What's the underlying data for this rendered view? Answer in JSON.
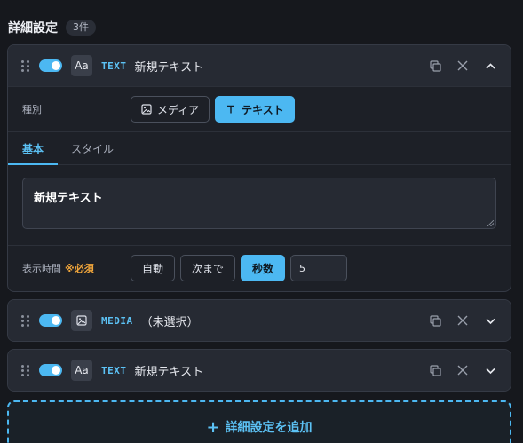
{
  "header": {
    "title": "詳細設定",
    "count": "3件"
  },
  "cards": [
    {
      "type_icon": "Aa",
      "type_label": "TEXT",
      "name": "新規テキスト",
      "toggle_on": true,
      "expanded": true
    },
    {
      "type_icon": "image-icon",
      "type_label": "MEDIA",
      "name": "（未選択）",
      "toggle_on": true,
      "expanded": false
    },
    {
      "type_icon": "Aa",
      "type_label": "TEXT",
      "name": "新規テキスト",
      "toggle_on": true,
      "expanded": false
    }
  ],
  "editor": {
    "kind_label": "種別",
    "kind_media": "メディア",
    "kind_text": "テキスト",
    "tab_basic": "基本",
    "tab_style": "スタイル",
    "text_value": "新規テキスト",
    "time_label": "表示時間",
    "required_mark": "※必須",
    "time_auto": "自動",
    "time_next": "次まで",
    "time_seconds": "秒数",
    "seconds_value": "5"
  },
  "add_button": {
    "label": "詳細設定を追加",
    "plus": "+"
  },
  "colors": {
    "accent": "#4cb8f2",
    "required": "#f0a53b",
    "background": "#16181d"
  }
}
